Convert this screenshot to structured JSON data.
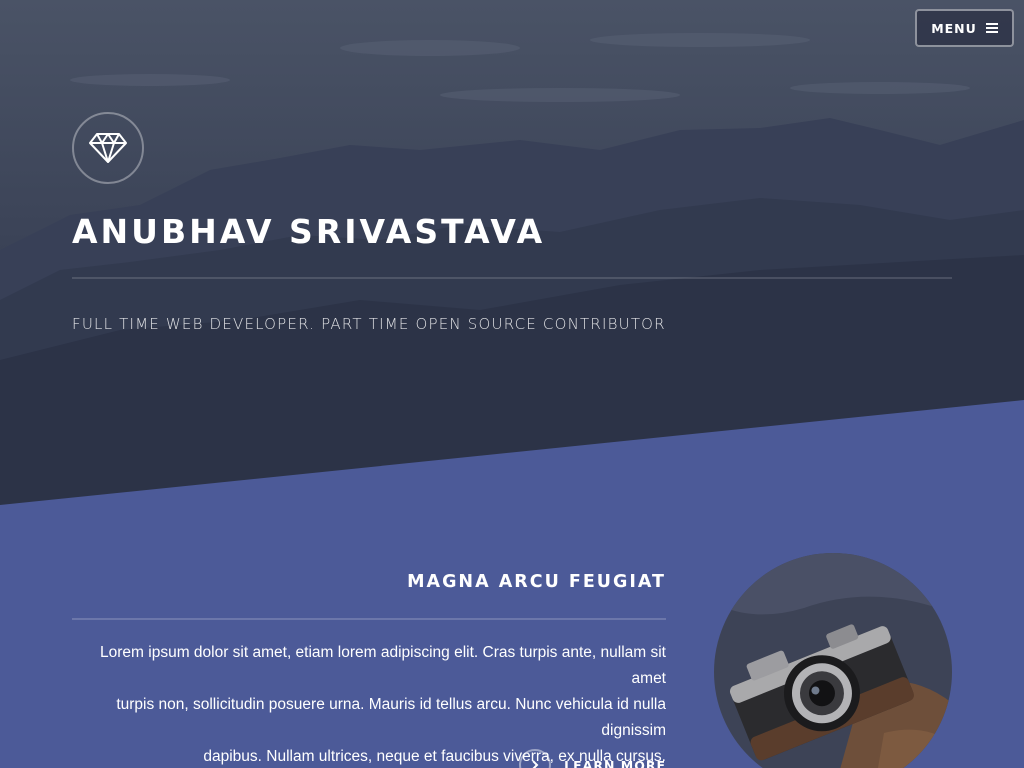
{
  "header": {
    "menu_label": "MENU",
    "menu_icon": "hamburger-icon"
  },
  "banner": {
    "logo_icon": "diamond-icon",
    "title": "ANUBHAV SRIVASTAVA",
    "tagline": "FULL TIME WEB DEVELOPER. PART TIME OPEN SOURCE CONTRIBUTOR"
  },
  "feature": {
    "heading": "MAGNA ARCU FEUGIAT",
    "body_lines": [
      "Lorem ipsum dolor sit amet, etiam lorem adipiscing elit. Cras turpis ante, nullam sit amet",
      "turpis non, sollicitudin posuere urna. Mauris id tellus arcu. Nunc vehicula id nulla dignissim",
      "dapibus. Nullam ultrices, neque et faucibus viverra, ex nulla cursus."
    ],
    "cta_label": "LEARN MORE",
    "cta_icon": "chevron-right-icon",
    "image": "camera-photo"
  },
  "colors": {
    "accent_blue": "#4c5a98",
    "banner_dark": "#2a3145",
    "text_white": "#ffffff"
  }
}
